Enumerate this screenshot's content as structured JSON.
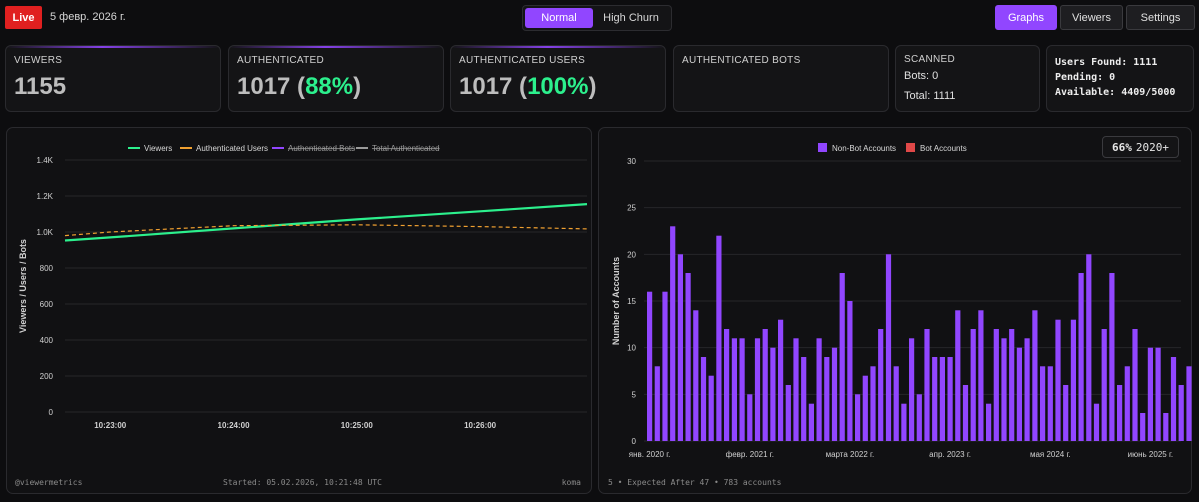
{
  "topbar": {
    "live_label": "Live",
    "date": "5 февр. 2026 г.",
    "mode_options": [
      "Normal",
      "High Churn"
    ],
    "active_mode": "Normal",
    "nav": [
      "Graphs",
      "Viewers",
      "Settings"
    ],
    "active_nav": "Graphs",
    "accent_color": "#9146ff",
    "live_color": "#e02020"
  },
  "stats": {
    "viewers": {
      "label": "VIEWERS",
      "value": "1155"
    },
    "authenticated": {
      "label": "AUTHENTICATED",
      "value": "1017",
      "pct_open": " (",
      "pct": "88%",
      "pct_close": ")"
    },
    "authenticated_users": {
      "label": "AUTHENTICATED USERS",
      "value": "1017",
      "pct_open": " (",
      "pct": "100%",
      "pct_close": ")"
    },
    "authenticated_bots": {
      "label": "AUTHENTICATED BOTS"
    },
    "scanned": {
      "label": "SCANNED",
      "bots": "Bots: 0",
      "total": "Total: 1111"
    },
    "status": {
      "users_found": "Users Found: 1111",
      "pending": "Pending: 0",
      "available": "Available: 4409/5000"
    },
    "positive_color": "#2cf08d"
  },
  "left_panel": {
    "footer_left": "@viewermetrics",
    "footer_mid": "Started: 05.02.2026, 10:21:48 UTC",
    "footer_right": "koma"
  },
  "right_panel": {
    "badge_pct": "66%",
    "badge_year": "2020+",
    "footer": "5 • Expected After 47 • 783 accounts"
  },
  "chart_data": [
    {
      "type": "line",
      "xlabel": "",
      "ylabel": "Viewers / Users / Bots",
      "x": [
        "10:22:38",
        "10:23:00",
        "10:24:00",
        "10:25:00",
        "10:26:00",
        "10:26:52"
      ],
      "x_ticks": [
        "10:23:00",
        "10:24:00",
        "10:25:00",
        "10:26:00"
      ],
      "y_ticks": [
        "0",
        "200",
        "400",
        "600",
        "800",
        "1.0K",
        "1.2K",
        "1.4K"
      ],
      "ylim": [
        0,
        1400
      ],
      "legend_position": "top-center",
      "grid": true,
      "series": [
        {
          "name": "Viewers",
          "color": "#2cf08d",
          "style": "solid",
          "hidden": false,
          "values": [
            953,
            970,
            1020,
            1070,
            1115,
            1155
          ]
        },
        {
          "name": "Authenticated Users",
          "color": "#f0a030",
          "style": "dashed",
          "hidden": false,
          "values": [
            980,
            1000,
            1035,
            1040,
            1030,
            1017
          ]
        },
        {
          "name": "Authenticated Bots",
          "color": "#9146ff",
          "style": "solid",
          "hidden": true,
          "values": []
        },
        {
          "name": "Total Authenticated",
          "color": "#9a9a9a",
          "style": "solid",
          "hidden": true,
          "values": []
        }
      ]
    },
    {
      "type": "bar",
      "ylabel": "Number of Accounts",
      "xlabel": "",
      "ylim": [
        0,
        30
      ],
      "y_ticks": [
        "0",
        "5",
        "10",
        "15",
        "20",
        "25",
        "30"
      ],
      "x_tick_labels": [
        {
          "label": "янв. 2020 г.",
          "index": 0
        },
        {
          "label": "февр. 2021 г.",
          "index": 13
        },
        {
          "label": "марта 2022 г.",
          "index": 26
        },
        {
          "label": "апр. 2023 г.",
          "index": 39
        },
        {
          "label": "мая 2024 г.",
          "index": 52
        },
        {
          "label": "июнь 2025 г.",
          "index": 65
        }
      ],
      "legend_position": "top-center",
      "grid": true,
      "series": [
        {
          "name": "Non-Bot Accounts",
          "color": "#9146ff",
          "values": [
            16,
            8,
            16,
            23,
            20,
            18,
            14,
            9,
            7,
            22,
            12,
            11,
            11,
            5,
            11,
            12,
            10,
            13,
            6,
            11,
            9,
            4,
            11,
            9,
            10,
            18,
            15,
            5,
            7,
            8,
            12,
            20,
            8,
            4,
            11,
            5,
            12,
            9,
            9,
            9,
            14,
            6,
            12,
            14,
            4,
            12,
            11,
            12,
            10,
            11,
            14,
            8,
            8,
            13,
            6,
            13,
            18,
            20,
            4,
            12,
            18,
            6,
            8,
            12,
            3,
            10,
            10,
            3,
            9,
            6,
            8,
            10,
            2,
            7
          ]
        },
        {
          "name": "Bot Accounts",
          "color": "#e04848",
          "values": []
        }
      ]
    }
  ]
}
